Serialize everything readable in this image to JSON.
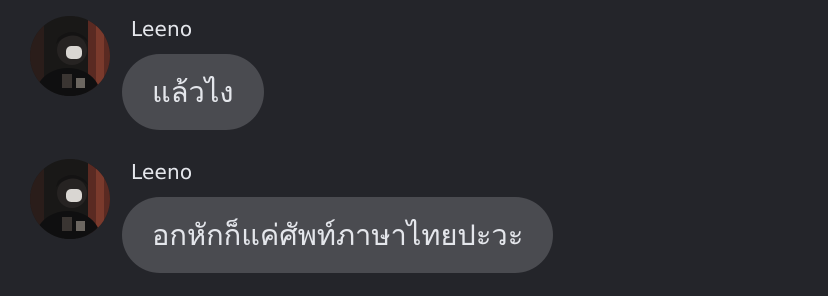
{
  "colors": {
    "background": "#24252a",
    "bubble": "#4a4b50",
    "text": "#e4e6eb"
  },
  "messages": [
    {
      "sender": "Leeno",
      "text": "แล้วไง",
      "avatar_icon": "user-photo-avatar"
    },
    {
      "sender": "Leeno",
      "text": "อกหักก็แค่ศัพท์ภาษาไทยปะวะ",
      "avatar_icon": "user-photo-avatar"
    }
  ]
}
